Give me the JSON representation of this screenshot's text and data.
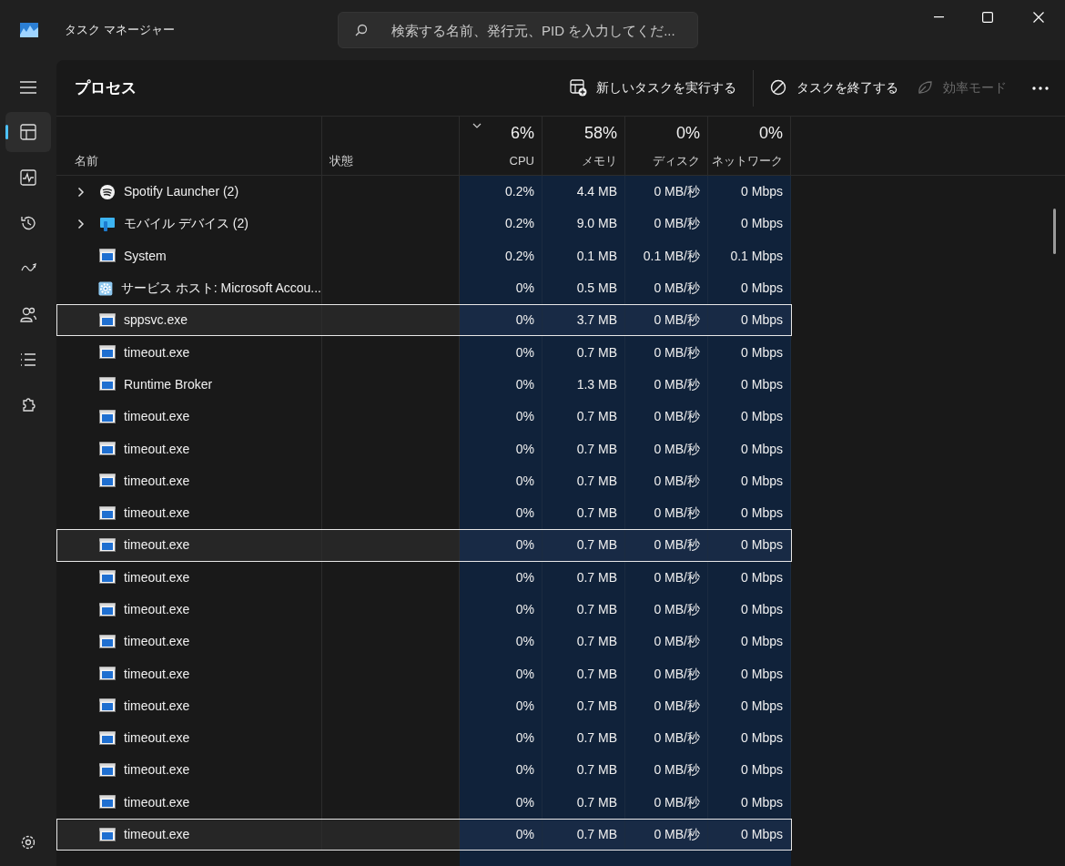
{
  "window": {
    "title": "タスク マネージャー"
  },
  "search": {
    "placeholder": "検索する名前、発行元、PID を入力してくだ..."
  },
  "sidebar": {
    "items": [
      {
        "kind": "processes",
        "selected": true
      },
      {
        "kind": "performance",
        "selected": false
      },
      {
        "kind": "history",
        "selected": false
      },
      {
        "kind": "startup",
        "selected": false
      },
      {
        "kind": "users",
        "selected": false
      },
      {
        "kind": "details",
        "selected": false
      },
      {
        "kind": "services",
        "selected": false
      }
    ]
  },
  "page": {
    "title": "プロセス"
  },
  "toolbar": [
    {
      "kind": "new",
      "label": "新しいタスクを実行する",
      "disabled": false
    },
    {
      "kind": "end",
      "label": "タスクを終了する",
      "disabled": false
    },
    {
      "kind": "eco",
      "label": "効率モード",
      "disabled": true
    }
  ],
  "table": {
    "columns": [
      {
        "label": "名前"
      },
      {
        "label": "状態"
      },
      {
        "total": "6%",
        "label": "CPU",
        "sorted": true
      },
      {
        "total": "58%",
        "label": "メモリ",
        "sorted": false
      },
      {
        "total": "0%",
        "label": "ディスク",
        "sorted": false
      },
      {
        "total": "0%",
        "label": "ネットワーク",
        "sorted": false
      }
    ],
    "rows": [
      {
        "kind": "spotify",
        "expandable": true,
        "name": "Spotify Launcher (2)",
        "cpu": "0.2%",
        "memory": "4.4 MB",
        "disk": "0 MB/秒",
        "network": "0 Mbps",
        "selected": false
      },
      {
        "kind": "device",
        "expandable": true,
        "name": "モバイル デバイス (2)",
        "cpu": "0.2%",
        "memory": "9.0 MB",
        "disk": "0 MB/秒",
        "network": "0 Mbps",
        "selected": false
      },
      {
        "kind": "app",
        "expandable": false,
        "name": "System",
        "cpu": "0.2%",
        "memory": "0.1 MB",
        "disk": "0.1 MB/秒",
        "network": "0.1 Mbps",
        "selected": false
      },
      {
        "kind": "gear",
        "expandable": false,
        "name": "サービス ホスト: Microsoft Accou...",
        "cpu": "0%",
        "memory": "0.5 MB",
        "disk": "0 MB/秒",
        "network": "0 Mbps",
        "selected": false
      },
      {
        "kind": "app",
        "expandable": false,
        "name": "sppsvc.exe",
        "cpu": "0%",
        "memory": "3.7 MB",
        "disk": "0 MB/秒",
        "network": "0 Mbps",
        "selected": true
      },
      {
        "kind": "app",
        "expandable": false,
        "name": "timeout.exe",
        "cpu": "0%",
        "memory": "0.7 MB",
        "disk": "0 MB/秒",
        "network": "0 Mbps",
        "selected": false
      },
      {
        "kind": "app",
        "expandable": false,
        "name": "Runtime Broker",
        "cpu": "0%",
        "memory": "1.3 MB",
        "disk": "0 MB/秒",
        "network": "0 Mbps",
        "selected": false
      },
      {
        "kind": "app",
        "expandable": false,
        "name": "timeout.exe",
        "cpu": "0%",
        "memory": "0.7 MB",
        "disk": "0 MB/秒",
        "network": "0 Mbps",
        "selected": false
      },
      {
        "kind": "app",
        "expandable": false,
        "name": "timeout.exe",
        "cpu": "0%",
        "memory": "0.7 MB",
        "disk": "0 MB/秒",
        "network": "0 Mbps",
        "selected": false
      },
      {
        "kind": "app",
        "expandable": false,
        "name": "timeout.exe",
        "cpu": "0%",
        "memory": "0.7 MB",
        "disk": "0 MB/秒",
        "network": "0 Mbps",
        "selected": false
      },
      {
        "kind": "app",
        "expandable": false,
        "name": "timeout.exe",
        "cpu": "0%",
        "memory": "0.7 MB",
        "disk": "0 MB/秒",
        "network": "0 Mbps",
        "selected": false
      },
      {
        "kind": "app",
        "expandable": false,
        "name": "timeout.exe",
        "cpu": "0%",
        "memory": "0.7 MB",
        "disk": "0 MB/秒",
        "network": "0 Mbps",
        "selected": true
      },
      {
        "kind": "app",
        "expandable": false,
        "name": "timeout.exe",
        "cpu": "0%",
        "memory": "0.7 MB",
        "disk": "0 MB/秒",
        "network": "0 Mbps",
        "selected": false
      },
      {
        "kind": "app",
        "expandable": false,
        "name": "timeout.exe",
        "cpu": "0%",
        "memory": "0.7 MB",
        "disk": "0 MB/秒",
        "network": "0 Mbps",
        "selected": false
      },
      {
        "kind": "app",
        "expandable": false,
        "name": "timeout.exe",
        "cpu": "0%",
        "memory": "0.7 MB",
        "disk": "0 MB/秒",
        "network": "0 Mbps",
        "selected": false
      },
      {
        "kind": "app",
        "expandable": false,
        "name": "timeout.exe",
        "cpu": "0%",
        "memory": "0.7 MB",
        "disk": "0 MB/秒",
        "network": "0 Mbps",
        "selected": false
      },
      {
        "kind": "app",
        "expandable": false,
        "name": "timeout.exe",
        "cpu": "0%",
        "memory": "0.7 MB",
        "disk": "0 MB/秒",
        "network": "0 Mbps",
        "selected": false
      },
      {
        "kind": "app",
        "expandable": false,
        "name": "timeout.exe",
        "cpu": "0%",
        "memory": "0.7 MB",
        "disk": "0 MB/秒",
        "network": "0 Mbps",
        "selected": false
      },
      {
        "kind": "app",
        "expandable": false,
        "name": "timeout.exe",
        "cpu": "0%",
        "memory": "0.7 MB",
        "disk": "0 MB/秒",
        "network": "0 Mbps",
        "selected": false
      },
      {
        "kind": "app",
        "expandable": false,
        "name": "timeout.exe",
        "cpu": "0%",
        "memory": "0.7 MB",
        "disk": "0 MB/秒",
        "network": "0 Mbps",
        "selected": false
      },
      {
        "kind": "app",
        "expandable": false,
        "name": "timeout.exe",
        "cpu": "0%",
        "memory": "0.7 MB",
        "disk": "0 MB/秒",
        "network": "0 Mbps",
        "selected": true
      }
    ]
  }
}
